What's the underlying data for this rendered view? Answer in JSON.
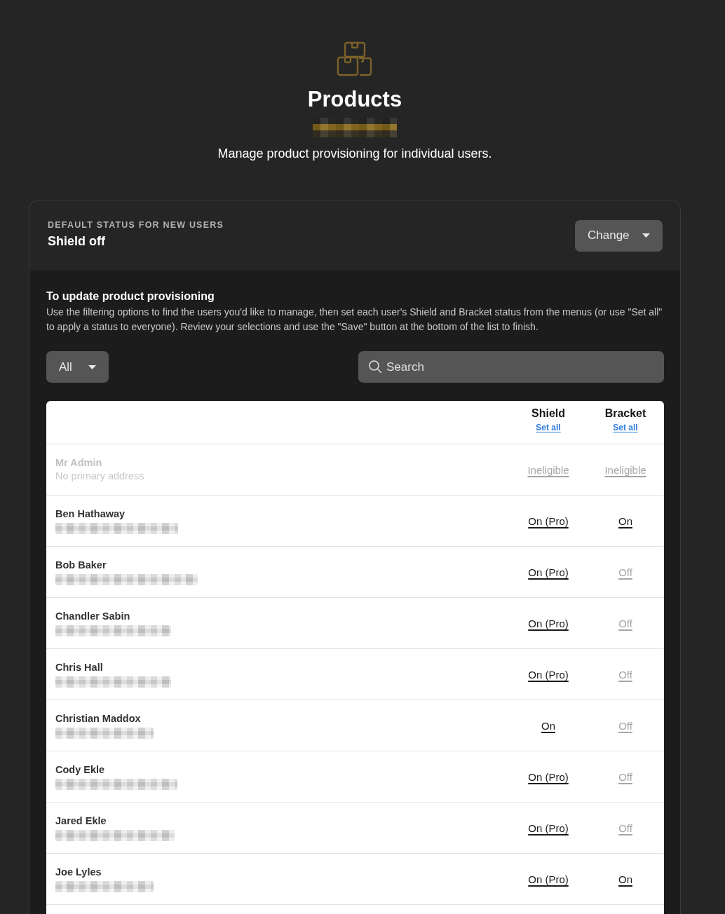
{
  "header": {
    "title": "Products",
    "redacted_line": true,
    "subtitle": "Manage product provisioning for individual users."
  },
  "default_status": {
    "label": "DEFAULT STATUS FOR NEW USERS",
    "value": "Shield off",
    "button": "Change"
  },
  "instructions": {
    "title": "To update product provisioning",
    "body": "Use the filtering options to find the users you'd like to manage, then set each user's Shield and Bracket status from the menus (or use \"Set all\" to apply a status to everyone). Review your selections and use the \"Save\" button at the bottom of the list to finish."
  },
  "filter": {
    "value": "All"
  },
  "search": {
    "placeholder": "Search"
  },
  "table": {
    "columns": [
      {
        "title": "Shield",
        "action": "Set all"
      },
      {
        "title": "Bracket",
        "action": "Set all"
      }
    ],
    "users": [
      {
        "name": "Mr Admin",
        "address": "No primary address",
        "address_blurred": false,
        "disabled": true,
        "shield": {
          "label": "Ineligible",
          "on": false
        },
        "bracket": {
          "label": "Ineligible",
          "on": false
        }
      },
      {
        "name": "Ben Hathaway",
        "address_blurred": true,
        "disabled": false,
        "shield": {
          "label": "On (Pro)",
          "on": true
        },
        "bracket": {
          "label": "On",
          "on": true
        }
      },
      {
        "name": "Bob Baker",
        "address_blurred": true,
        "disabled": false,
        "shield": {
          "label": "On (Pro)",
          "on": true
        },
        "bracket": {
          "label": "Off",
          "on": false
        }
      },
      {
        "name": "Chandler Sabin",
        "address_blurred": true,
        "disabled": false,
        "shield": {
          "label": "On (Pro)",
          "on": true
        },
        "bracket": {
          "label": "Off",
          "on": false
        }
      },
      {
        "name": "Chris Hall",
        "address_blurred": true,
        "disabled": false,
        "shield": {
          "label": "On (Pro)",
          "on": true
        },
        "bracket": {
          "label": "Off",
          "on": false
        }
      },
      {
        "name": "Christian Maddox",
        "address_blurred": true,
        "disabled": false,
        "shield": {
          "label": "On",
          "on": true
        },
        "bracket": {
          "label": "Off",
          "on": false
        }
      },
      {
        "name": "Cody Ekle",
        "address_blurred": true,
        "disabled": false,
        "shield": {
          "label": "On (Pro)",
          "on": true
        },
        "bracket": {
          "label": "Off",
          "on": false
        }
      },
      {
        "name": "Jared Ekle",
        "address_blurred": true,
        "disabled": false,
        "shield": {
          "label": "On (Pro)",
          "on": true
        },
        "bracket": {
          "label": "Off",
          "on": false
        }
      },
      {
        "name": "Joe Lyles",
        "address_blurred": true,
        "disabled": false,
        "shield": {
          "label": "On (Pro)",
          "on": true
        },
        "bracket": {
          "label": "On",
          "on": true
        }
      }
    ]
  }
}
